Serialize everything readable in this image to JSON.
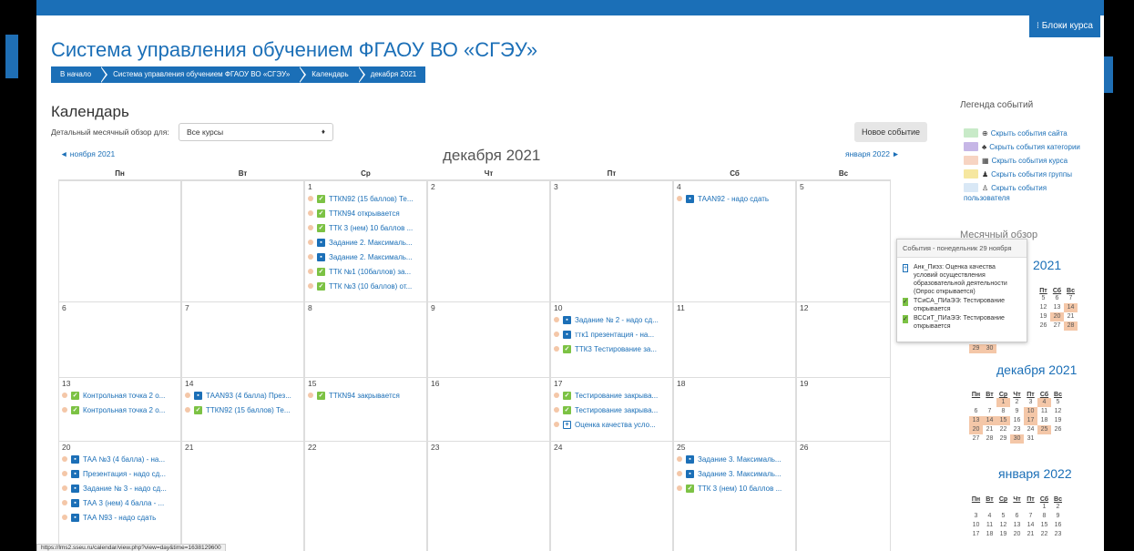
{
  "header": {
    "blocks_button": "⁝ Блоки курса",
    "site_title": "Система управления обучением ФГАОУ ВО «СГЭУ»"
  },
  "breadcrumb": [
    "В начало",
    "Система управления обучением ФГАОУ ВО «СГЭУ»",
    "Календарь",
    "декабря 2021"
  ],
  "calendar": {
    "heading": "Календарь",
    "filter_label": "Детальный месячный обзор для:",
    "course_select": "Все курсы",
    "new_event": "Новое событие",
    "prev_month": "◄ ноября 2021",
    "next_month": "января 2022 ►",
    "month_title": "декабря 2021",
    "weekdays": [
      "Пн",
      "Вт",
      "Ср",
      "Чт",
      "Пт",
      "Сб",
      "Вс"
    ],
    "weeks": [
      {
        "days": [
          {
            "num": "",
            "events": []
          },
          {
            "num": "",
            "events": []
          },
          {
            "num": "1",
            "events": [
              {
                "icon": "g",
                "text": "ТТКN92 (15 баллов) Те..."
              },
              {
                "icon": "g",
                "text": "ТТКN94 открывается"
              },
              {
                "icon": "g",
                "text": "ТТК 3 (нем) 10 баллов ..."
              },
              {
                "icon": "b",
                "text": "Задание 2. Максималь..."
              },
              {
                "icon": "b",
                "text": "Задание 2. Максималь..."
              },
              {
                "icon": "g",
                "text": "ТТК №1 (10баллов) за..."
              },
              {
                "icon": "g",
                "text": "ТТК №3 (10 баллов) от..."
              }
            ]
          },
          {
            "num": "2",
            "events": []
          },
          {
            "num": "3",
            "events": []
          },
          {
            "num": "4",
            "events": [
              {
                "icon": "b",
                "text": "ТААN92 - надо сдать"
              }
            ]
          },
          {
            "num": "5",
            "events": []
          }
        ]
      },
      {
        "days": [
          {
            "num": "6",
            "events": []
          },
          {
            "num": "7",
            "events": []
          },
          {
            "num": "8",
            "events": []
          },
          {
            "num": "9",
            "events": []
          },
          {
            "num": "10",
            "events": [
              {
                "icon": "b",
                "text": "Задание № 2 - надо сд..."
              },
              {
                "icon": "b",
                "text": "ттк1 презентация - на..."
              },
              {
                "icon": "g",
                "text": "ТТК3 Тестирование за..."
              }
            ]
          },
          {
            "num": "11",
            "events": []
          },
          {
            "num": "12",
            "events": []
          }
        ]
      },
      {
        "days": [
          {
            "num": "13",
            "events": [
              {
                "icon": "g",
                "text": "Контрольная точка 2 о..."
              },
              {
                "icon": "g",
                "text": "Контрольная точка 2 о..."
              }
            ]
          },
          {
            "num": "14",
            "events": [
              {
                "icon": "b",
                "text": "ТААN93 (4 балла) През..."
              },
              {
                "icon": "g",
                "text": "ТТКN92 (15 баллов) Те..."
              }
            ]
          },
          {
            "num": "15",
            "events": [
              {
                "icon": "g",
                "text": "ТТКN94 закрывается"
              }
            ]
          },
          {
            "num": "16",
            "events": []
          },
          {
            "num": "17",
            "events": [
              {
                "icon": "g",
                "text": "Тестирование закрыва..."
              },
              {
                "icon": "g",
                "text": "Тестирование закрыва..."
              },
              {
                "icon": "o",
                "text": "Оценка качества усло..."
              }
            ]
          },
          {
            "num": "18",
            "events": []
          },
          {
            "num": "19",
            "events": []
          }
        ]
      },
      {
        "days": [
          {
            "num": "20",
            "events": [
              {
                "icon": "b",
                "text": "ТАА №3 (4 балла) - на..."
              },
              {
                "icon": "b",
                "text": "Презентация - надо сд..."
              },
              {
                "icon": "b",
                "text": "Задание № 3 - надо сд..."
              },
              {
                "icon": "b",
                "text": "ТАА 3 (нем) 4 балла - ..."
              },
              {
                "icon": "b",
                "text": "ТАА N93 - надо сдать"
              }
            ]
          },
          {
            "num": "21",
            "events": []
          },
          {
            "num": "22",
            "events": []
          },
          {
            "num": "23",
            "events": []
          },
          {
            "num": "24",
            "events": []
          },
          {
            "num": "25",
            "events": [
              {
                "icon": "b",
                "text": "Задание 3. Максималь..."
              },
              {
                "icon": "b",
                "text": "Задание 3. Максималь..."
              },
              {
                "icon": "g",
                "text": "ТТК 3 (нем) 10 баллов ..."
              }
            ]
          },
          {
            "num": "26",
            "events": []
          }
        ]
      }
    ]
  },
  "legend": {
    "title": "Легенда событий",
    "items": [
      {
        "text": "Скрыть события сайта",
        "sym": "⊕",
        "color": "#c8eac8"
      },
      {
        "text": "Скрыть события категории",
        "sym": "♣",
        "color": "#c6b6e6"
      },
      {
        "text": "Скрыть события курса",
        "sym": "▦",
        "color": "#f7d4c2"
      },
      {
        "text": "Скрыть события группы",
        "sym": "♟",
        "color": "#f6e7a0"
      },
      {
        "text": "Скрыть события",
        "sym": "♙",
        "color": "#d9e8f6"
      }
    ],
    "user_line2": "пользователя"
  },
  "monthly": {
    "title": "Месячный обзор",
    "nov_title": "2021",
    "nov_partial": [
      [
        "Пт",
        "Сб",
        "Вс"
      ],
      [
        "5",
        "6",
        "7"
      ],
      [
        "12",
        "13",
        "14"
      ],
      [
        "19",
        "20",
        "21"
      ],
      [
        "26",
        "27",
        "28"
      ]
    ],
    "nov_last": [
      "29",
      "30"
    ],
    "dec_title": "декабря 2021",
    "jan_title": "января 2022",
    "headers": [
      "Пн",
      "Вт",
      "Ср",
      "Чт",
      "Пт",
      "Сб",
      "Вс"
    ],
    "dec_rows": [
      [
        "",
        "",
        "1",
        "2",
        "3",
        "4",
        "5"
      ],
      [
        "6",
        "7",
        "8",
        "9",
        "10",
        "11",
        "12"
      ],
      [
        "13",
        "14",
        "15",
        "16",
        "17",
        "18",
        "19"
      ],
      [
        "20",
        "21",
        "22",
        "23",
        "24",
        "25",
        "26"
      ],
      [
        "27",
        "28",
        "29",
        "30",
        "31",
        "",
        ""
      ]
    ],
    "jan_rows": [
      [
        "",
        "",
        "",
        "",
        "",
        "1",
        "2"
      ],
      [
        "3",
        "4",
        "5",
        "6",
        "7",
        "8",
        "9"
      ],
      [
        "10",
        "11",
        "12",
        "13",
        "14",
        "15",
        "16"
      ],
      [
        "17",
        "18",
        "19",
        "20",
        "21",
        "22",
        "23"
      ]
    ]
  },
  "popup": {
    "title": "События - понедельник 29 ноября",
    "items": [
      {
        "icon": "o",
        "text": "Анк_Пиэз: Оценка качества условий осуществления образовательной деятельности (Опрос открывается)"
      },
      {
        "icon": "g",
        "text": "ТСиСА_ПИаЭЭ: Тестирование открывается"
      },
      {
        "icon": "g",
        "text": "ВССиТ_ПИаЭЭ: Тестирование открывается"
      }
    ]
  },
  "status_url": "https://lms2.sseu.ru/calendar/view.php?view=day&time=1638129600"
}
